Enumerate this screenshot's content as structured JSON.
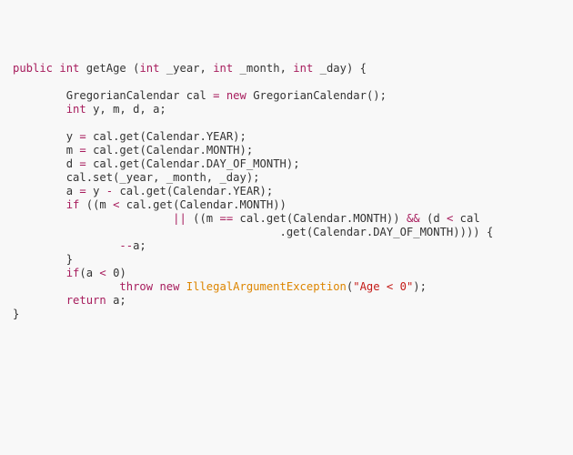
{
  "code": {
    "t_public": "public",
    "t_int": "int",
    "t_getAge": "getAge",
    "t_lpar": "(",
    "t_rpar": ")",
    "t_year": "_year",
    "t_month": "_month",
    "t_day": "_day",
    "t_comma": ",",
    "t_lbrace": "{",
    "t_rbrace": "}",
    "t_GregorianCalendar": "GregorianCalendar",
    "t_cal": "cal",
    "t_eq": "=",
    "t_new": "new",
    "t_semicolon": ";",
    "t_vars": "y, m, d, a;",
    "t_y": "y",
    "t_m": "m",
    "t_d": "d",
    "t_a": "a",
    "t_calget": "cal.get(Calendar.YEAR);",
    "t_calgetM": "cal.get(Calendar.MONTH);",
    "t_calgetD": "cal.get(Calendar.DAY_OF_MONTH);",
    "t_calset": "cal.set(_year, _month, _day);",
    "t_calgetY2": "cal.get(Calendar.YEAR);",
    "t_minus": "-",
    "t_if": "if",
    "t_cond1a": "((m ",
    "t_lt": "<",
    "t_cond1b": " cal.get(Calendar.MONTH))",
    "t_or": "||",
    "t_cond2a": " ((m ",
    "t_eqeq": "==",
    "t_cond2b": " cal.get(Calendar.MONTH)) ",
    "t_andand": "&&",
    "t_cond2c": " (d ",
    "t_cond2d": " cal",
    "t_cond3": ".get(Calendar.DAY_OF_MONTH)))) {",
    "t_dec": "--",
    "t_asemi": "a;",
    "t_ifab": "(a ",
    "t_zero": "0",
    "t_rpar2": ")",
    "t_throw": "throw",
    "t_IAE": "IllegalArgumentException",
    "t_str": "\"Age < 0\"",
    "t_return": "return",
    "t_retA": " a;",
    "t_openparen_str": "(",
    "t_closeparen_semi": ");"
  }
}
